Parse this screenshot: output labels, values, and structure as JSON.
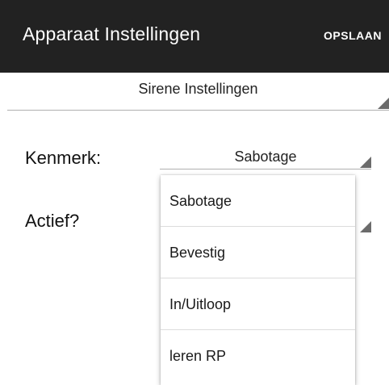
{
  "appbar": {
    "title": "Apparaat Instellingen",
    "action_label": "OPSLAAN"
  },
  "section_spinner": {
    "selected": "Sirene Instellingen"
  },
  "form": {
    "kenmerk_label": "Kenmerk:",
    "kenmerk_value": "Sabotage",
    "actief_label": "Actief?"
  },
  "dropdown": {
    "items": [
      {
        "label": "Sabotage"
      },
      {
        "label": "Bevestig"
      },
      {
        "label": "In/Uitloop"
      },
      {
        "label": "leren RP"
      }
    ]
  },
  "colors": {
    "appbar_background": "#222222",
    "appbar_text": "#ffffff",
    "spinner_arrow": "#6b6b6b"
  }
}
